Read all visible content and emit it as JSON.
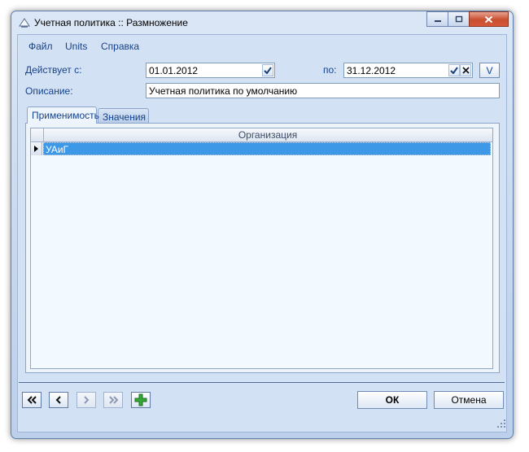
{
  "window": {
    "title": "Учетная политика :: Размножение"
  },
  "menu": [
    {
      "label": "Файл"
    },
    {
      "label": "Units"
    },
    {
      "label": "Справка"
    }
  ],
  "form": {
    "from_label": "Действует с:",
    "from_value": "01.01.2012",
    "to_label": "по:",
    "to_value": "31.12.2012",
    "v_button": "V",
    "description_label": "Описание:",
    "description_value": "Учетная политика по умолчанию"
  },
  "tabs": [
    {
      "label": "Применимость",
      "active": true
    },
    {
      "label": "Значения",
      "active": false
    }
  ],
  "grid": {
    "columns": [
      "Организация"
    ],
    "rows": [
      {
        "organization": "УАиГ",
        "selected": true
      }
    ]
  },
  "footer": {
    "nav_first": "«",
    "nav_prev": "‹",
    "nav_next": "›",
    "nav_last": "»",
    "ok_label": "ОК",
    "cancel_label": "Отмена"
  },
  "icons": {
    "app": "window-app-icon",
    "minimize": "minimize-icon",
    "maximize": "maximize-icon",
    "close": "close-icon",
    "check": "check-icon",
    "clear": "clear-x-icon",
    "add": "plus-icon",
    "row_pointer": "row-pointer-icon",
    "resize": "resize-grip-icon"
  },
  "colors": {
    "selection": "#3d99e8",
    "add_icon": "#2f9e2f",
    "close_button": "#c84f2f"
  }
}
